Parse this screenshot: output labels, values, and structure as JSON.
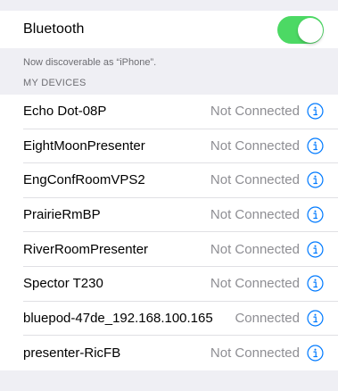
{
  "bluetooth": {
    "label": "Bluetooth",
    "enabled": true,
    "toggle_color": "#4cd964"
  },
  "discoverable_text": "Now discoverable as “iPhone”.",
  "my_devices": {
    "header": "MY DEVICES",
    "items": [
      {
        "name": "Echo Dot-08P",
        "status": "Not Connected"
      },
      {
        "name": "EightMoonPresenter",
        "status": "Not Connected"
      },
      {
        "name": "EngConfRoomVPS2",
        "status": "Not Connected"
      },
      {
        "name": "PrairieRmBP",
        "status": "Not Connected"
      },
      {
        "name": "RiverRoomPresenter",
        "status": "Not Connected"
      },
      {
        "name": "Spector T230",
        "status": "Not Connected"
      },
      {
        "name": "bluepod-47de_192.168.100.165",
        "status": "Connected"
      },
      {
        "name": "presenter-RicFB",
        "status": "Not Connected"
      }
    ]
  },
  "icons": {
    "info": "info-circle-icon"
  },
  "colors": {
    "accent": "#007aff",
    "secondary_text": "#8e8e93",
    "background": "#efeff4"
  }
}
